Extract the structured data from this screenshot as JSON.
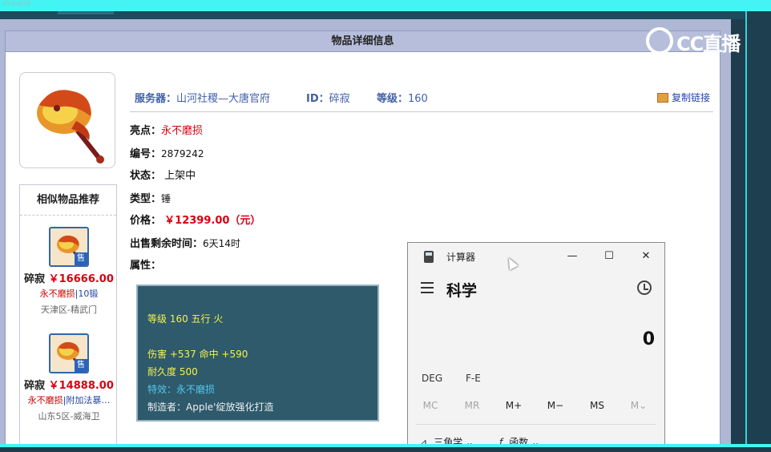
{
  "screen": {
    "dimension_label": "959x639"
  },
  "panel": {
    "title": "物品详细信息"
  },
  "item": {
    "server_label": "服务器：",
    "server_value": "山河社稷—大唐官府",
    "id_label": "ID：",
    "id_value": "碎寂",
    "level_label": "等级：",
    "level_value": "160",
    "copy_link_label": "复制链接",
    "highlight_label": "亮点：",
    "highlight_value": "永不磨损",
    "serial_label": "编号：",
    "serial_value": "2879242",
    "status_label": "状态：",
    "status_value": "上架中",
    "type_label": "类型：",
    "type_value": "锤",
    "price_label": "价格：",
    "price_value": "￥12399.00（元）",
    "remaining_label": "出售剩余时间：",
    "remaining_value": "6天14时",
    "attributes_label": "属性："
  },
  "attributes": {
    "line1": "等级 160 五行 火",
    "line2": "伤害 +537 命中 +590",
    "line3": "耐久度 500",
    "line4": "特效：永不磨损",
    "line5": "制造者：Apple'绽放强化打造"
  },
  "recommendations": {
    "title": "相似物品推荐",
    "badge": "售",
    "items": [
      {
        "name": "碎寂",
        "price": "￥16666.00",
        "tag": "永不磨损",
        "tag_extra": "|10锻",
        "server": "天津区-精武门"
      },
      {
        "name": "碎寂",
        "price": "￥14888.00",
        "tag": "永不磨损",
        "tag_extra": "|附加法暴…",
        "server": "山东5区-威海卫"
      }
    ]
  },
  "brand": {
    "text": "CC直播"
  },
  "calculator": {
    "title": "计算器",
    "mode": "科学",
    "display": "0",
    "minimize": "—",
    "maximize": "☐",
    "close": "✕",
    "deg": "DEG",
    "fe": "F-E",
    "mem": [
      "MC",
      "MR",
      "M+",
      "M−",
      "MS",
      "M⌄"
    ],
    "trig_label": "三角学",
    "func_label": "函数",
    "chevron": "⌄"
  }
}
